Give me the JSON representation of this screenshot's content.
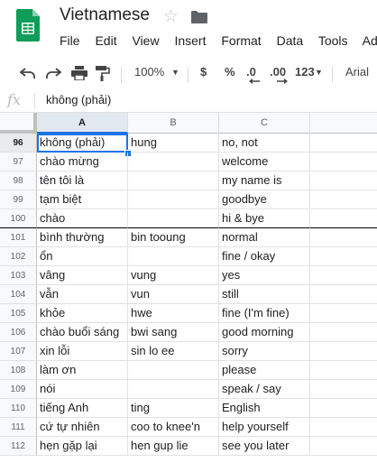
{
  "doc": {
    "title": "Vietnamese",
    "menu": [
      "File",
      "Edit",
      "View",
      "Insert",
      "Format",
      "Data",
      "Tools",
      "Add-"
    ]
  },
  "toolbar": {
    "zoom": "100%",
    "currency": "$",
    "percent": "%",
    "decimal_decrease": ".0",
    "decimal_increase": ".00",
    "more_formats": "123",
    "font": "Arial"
  },
  "formula_bar": {
    "fx": "fx",
    "value": "không (phải)"
  },
  "columns": [
    "A",
    "B",
    "C"
  ],
  "rows": [
    {
      "n": "96",
      "a": "không (phải)",
      "b": "hung",
      "c": "no, not"
    },
    {
      "n": "97",
      "a": "chào mừng",
      "b": "",
      "c": "welcome"
    },
    {
      "n": "98",
      "a": "tên tôi là",
      "b": "",
      "c": "my name is"
    },
    {
      "n": "99",
      "a": "tạm biệt",
      "b": "",
      "c": "goodbye"
    },
    {
      "n": "100",
      "a": "chào",
      "b": "",
      "c": "hi & bye"
    },
    {
      "n": "101",
      "a": "bình thường",
      "b": "bin tooung",
      "c": "normal"
    },
    {
      "n": "102",
      "a": "ổn",
      "b": "",
      "c": "fine / okay"
    },
    {
      "n": "103",
      "a": "vâng",
      "b": "vung",
      "c": "yes"
    },
    {
      "n": "104",
      "a": "vẫn",
      "b": "vun",
      "c": "still"
    },
    {
      "n": "105",
      "a": "khỏe",
      "b": "hwe",
      "c": "fine (I'm fine)"
    },
    {
      "n": "106",
      "a": "chào buổi sáng",
      "b": "bwi sang",
      "c": "good morning"
    },
    {
      "n": "107",
      "a": "xin lỗi",
      "b": "sin lo ee",
      "c": "sorry"
    },
    {
      "n": "108",
      "a": "làm ơn",
      "b": "",
      "c": "please"
    },
    {
      "n": "109",
      "a": "nói",
      "b": "",
      "c": "speak / say"
    },
    {
      "n": "110",
      "a": "tiếng Anh",
      "b": "ting",
      "c": "English"
    },
    {
      "n": "111",
      "a": "cứ tự nhiên",
      "b": "coo to knee'n",
      "c": "help yourself"
    },
    {
      "n": "112",
      "a": "hẹn gặp lại",
      "b": "hen gup lie",
      "c": "see you later"
    }
  ]
}
